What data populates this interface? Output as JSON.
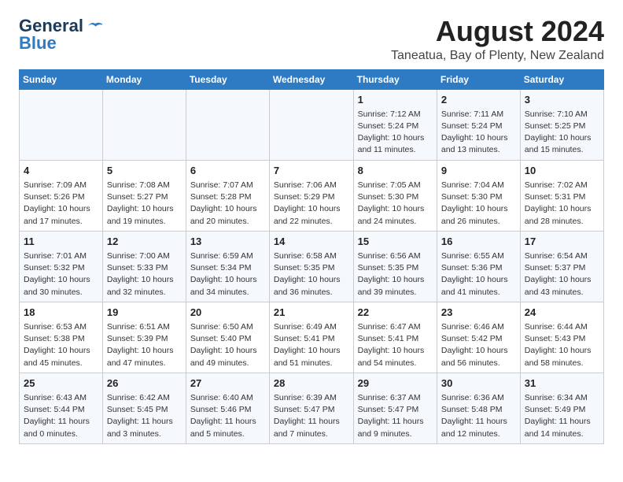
{
  "logo": {
    "general": "General",
    "blue": "Blue"
  },
  "title": "August 2024",
  "location": "Taneatua, Bay of Plenty, New Zealand",
  "weekdays": [
    "Sunday",
    "Monday",
    "Tuesday",
    "Wednesday",
    "Thursday",
    "Friday",
    "Saturday"
  ],
  "weeks": [
    [
      {
        "day": "",
        "info": ""
      },
      {
        "day": "",
        "info": ""
      },
      {
        "day": "",
        "info": ""
      },
      {
        "day": "",
        "info": ""
      },
      {
        "day": "1",
        "info": "Sunrise: 7:12 AM\nSunset: 5:24 PM\nDaylight: 10 hours\nand 11 minutes."
      },
      {
        "day": "2",
        "info": "Sunrise: 7:11 AM\nSunset: 5:24 PM\nDaylight: 10 hours\nand 13 minutes."
      },
      {
        "day": "3",
        "info": "Sunrise: 7:10 AM\nSunset: 5:25 PM\nDaylight: 10 hours\nand 15 minutes."
      }
    ],
    [
      {
        "day": "4",
        "info": "Sunrise: 7:09 AM\nSunset: 5:26 PM\nDaylight: 10 hours\nand 17 minutes."
      },
      {
        "day": "5",
        "info": "Sunrise: 7:08 AM\nSunset: 5:27 PM\nDaylight: 10 hours\nand 19 minutes."
      },
      {
        "day": "6",
        "info": "Sunrise: 7:07 AM\nSunset: 5:28 PM\nDaylight: 10 hours\nand 20 minutes."
      },
      {
        "day": "7",
        "info": "Sunrise: 7:06 AM\nSunset: 5:29 PM\nDaylight: 10 hours\nand 22 minutes."
      },
      {
        "day": "8",
        "info": "Sunrise: 7:05 AM\nSunset: 5:30 PM\nDaylight: 10 hours\nand 24 minutes."
      },
      {
        "day": "9",
        "info": "Sunrise: 7:04 AM\nSunset: 5:30 PM\nDaylight: 10 hours\nand 26 minutes."
      },
      {
        "day": "10",
        "info": "Sunrise: 7:02 AM\nSunset: 5:31 PM\nDaylight: 10 hours\nand 28 minutes."
      }
    ],
    [
      {
        "day": "11",
        "info": "Sunrise: 7:01 AM\nSunset: 5:32 PM\nDaylight: 10 hours\nand 30 minutes."
      },
      {
        "day": "12",
        "info": "Sunrise: 7:00 AM\nSunset: 5:33 PM\nDaylight: 10 hours\nand 32 minutes."
      },
      {
        "day": "13",
        "info": "Sunrise: 6:59 AM\nSunset: 5:34 PM\nDaylight: 10 hours\nand 34 minutes."
      },
      {
        "day": "14",
        "info": "Sunrise: 6:58 AM\nSunset: 5:35 PM\nDaylight: 10 hours\nand 36 minutes."
      },
      {
        "day": "15",
        "info": "Sunrise: 6:56 AM\nSunset: 5:35 PM\nDaylight: 10 hours\nand 39 minutes."
      },
      {
        "day": "16",
        "info": "Sunrise: 6:55 AM\nSunset: 5:36 PM\nDaylight: 10 hours\nand 41 minutes."
      },
      {
        "day": "17",
        "info": "Sunrise: 6:54 AM\nSunset: 5:37 PM\nDaylight: 10 hours\nand 43 minutes."
      }
    ],
    [
      {
        "day": "18",
        "info": "Sunrise: 6:53 AM\nSunset: 5:38 PM\nDaylight: 10 hours\nand 45 minutes."
      },
      {
        "day": "19",
        "info": "Sunrise: 6:51 AM\nSunset: 5:39 PM\nDaylight: 10 hours\nand 47 minutes."
      },
      {
        "day": "20",
        "info": "Sunrise: 6:50 AM\nSunset: 5:40 PM\nDaylight: 10 hours\nand 49 minutes."
      },
      {
        "day": "21",
        "info": "Sunrise: 6:49 AM\nSunset: 5:41 PM\nDaylight: 10 hours\nand 51 minutes."
      },
      {
        "day": "22",
        "info": "Sunrise: 6:47 AM\nSunset: 5:41 PM\nDaylight: 10 hours\nand 54 minutes."
      },
      {
        "day": "23",
        "info": "Sunrise: 6:46 AM\nSunset: 5:42 PM\nDaylight: 10 hours\nand 56 minutes."
      },
      {
        "day": "24",
        "info": "Sunrise: 6:44 AM\nSunset: 5:43 PM\nDaylight: 10 hours\nand 58 minutes."
      }
    ],
    [
      {
        "day": "25",
        "info": "Sunrise: 6:43 AM\nSunset: 5:44 PM\nDaylight: 11 hours\nand 0 minutes."
      },
      {
        "day": "26",
        "info": "Sunrise: 6:42 AM\nSunset: 5:45 PM\nDaylight: 11 hours\nand 3 minutes."
      },
      {
        "day": "27",
        "info": "Sunrise: 6:40 AM\nSunset: 5:46 PM\nDaylight: 11 hours\nand 5 minutes."
      },
      {
        "day": "28",
        "info": "Sunrise: 6:39 AM\nSunset: 5:47 PM\nDaylight: 11 hours\nand 7 minutes."
      },
      {
        "day": "29",
        "info": "Sunrise: 6:37 AM\nSunset: 5:47 PM\nDaylight: 11 hours\nand 9 minutes."
      },
      {
        "day": "30",
        "info": "Sunrise: 6:36 AM\nSunset: 5:48 PM\nDaylight: 11 hours\nand 12 minutes."
      },
      {
        "day": "31",
        "info": "Sunrise: 6:34 AM\nSunset: 5:49 PM\nDaylight: 11 hours\nand 14 minutes."
      }
    ]
  ]
}
